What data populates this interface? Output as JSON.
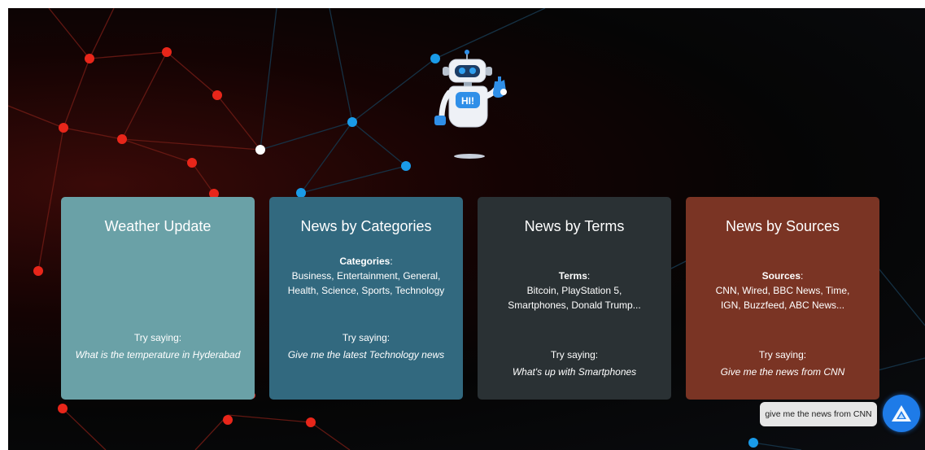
{
  "cards": [
    {
      "title": "Weather Update",
      "desc_label": "",
      "desc_text": "",
      "try_label": "Try saying:",
      "example": "What is the temperature in Hyderabad",
      "color": "#6aa1a7"
    },
    {
      "title": "News by Categories",
      "desc_label": "Categories",
      "desc_text": "Business, Entertainment, General, Health, Science, Sports, Technology",
      "try_label": "Try saying:",
      "example": "Give me the latest Technology news",
      "color": "#32697f"
    },
    {
      "title": "News by Terms",
      "desc_label": "Terms",
      "desc_text": "Bitcoin, PlayStation 5, Smartphones, Donald Trump...",
      "try_label": "Try saying:",
      "example": "What's up with Smartphones",
      "color": "#2a3134"
    },
    {
      "title": "News by Sources",
      "desc_label": "Sources",
      "desc_text": "CNN, Wired, BBC News, Time, IGN, Buzzfeed, ABC News...",
      "try_label": "Try saying:",
      "example": "Give me the news from CNN",
      "color": "#7a3424"
    }
  ],
  "robot": {
    "sign": "HI!"
  },
  "voice": {
    "transcript": "give me the news from CNN"
  },
  "icons": {
    "assistant_button": "alan-ai-logo-icon",
    "mascot": "robot-waving-icon"
  },
  "accent_colors": {
    "network_red": "#e8261a",
    "network_blue": "#1a9be8",
    "assistant": "#1e7be8"
  }
}
